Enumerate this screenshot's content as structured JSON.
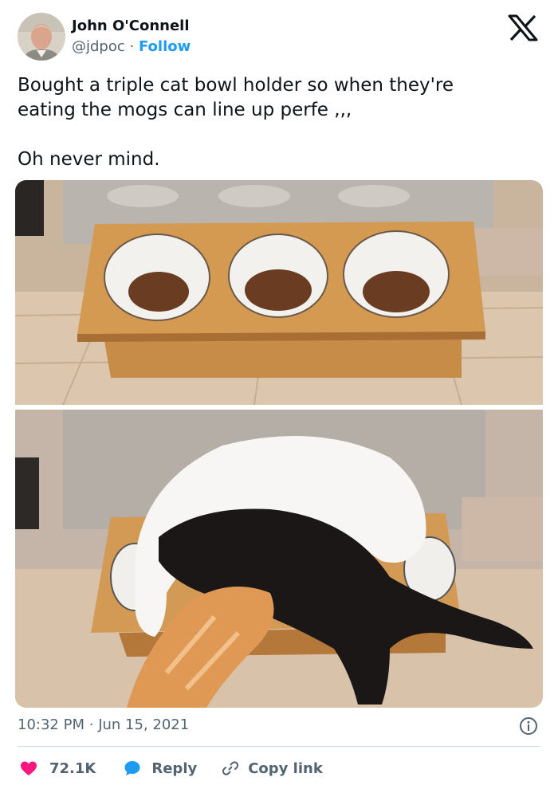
{
  "author": {
    "name": "John O'Connell",
    "handle": "@jdpoc",
    "separator": "·",
    "follow_label": "Follow"
  },
  "tweet": {
    "line_1": "Bought a triple cat bowl holder so when they're",
    "line_2": "eating the mogs can line up perfe ,,,",
    "line_3": "Oh never mind."
  },
  "media": [
    {
      "description_icon": "photo-empty-bowls"
    },
    {
      "description_icon": "photo-cats-eating"
    }
  ],
  "meta": {
    "time": "10:32 PM",
    "separator": "·",
    "date": "Jun 15, 2021"
  },
  "actions": {
    "likes": "72.1K",
    "reply_label": "Reply",
    "copy_label": "Copy link"
  },
  "colors": {
    "text": "#0f1419",
    "secondary": "#536471",
    "link": "#1d9bf0",
    "like": "#f91880",
    "divider": "#cfd9de"
  }
}
